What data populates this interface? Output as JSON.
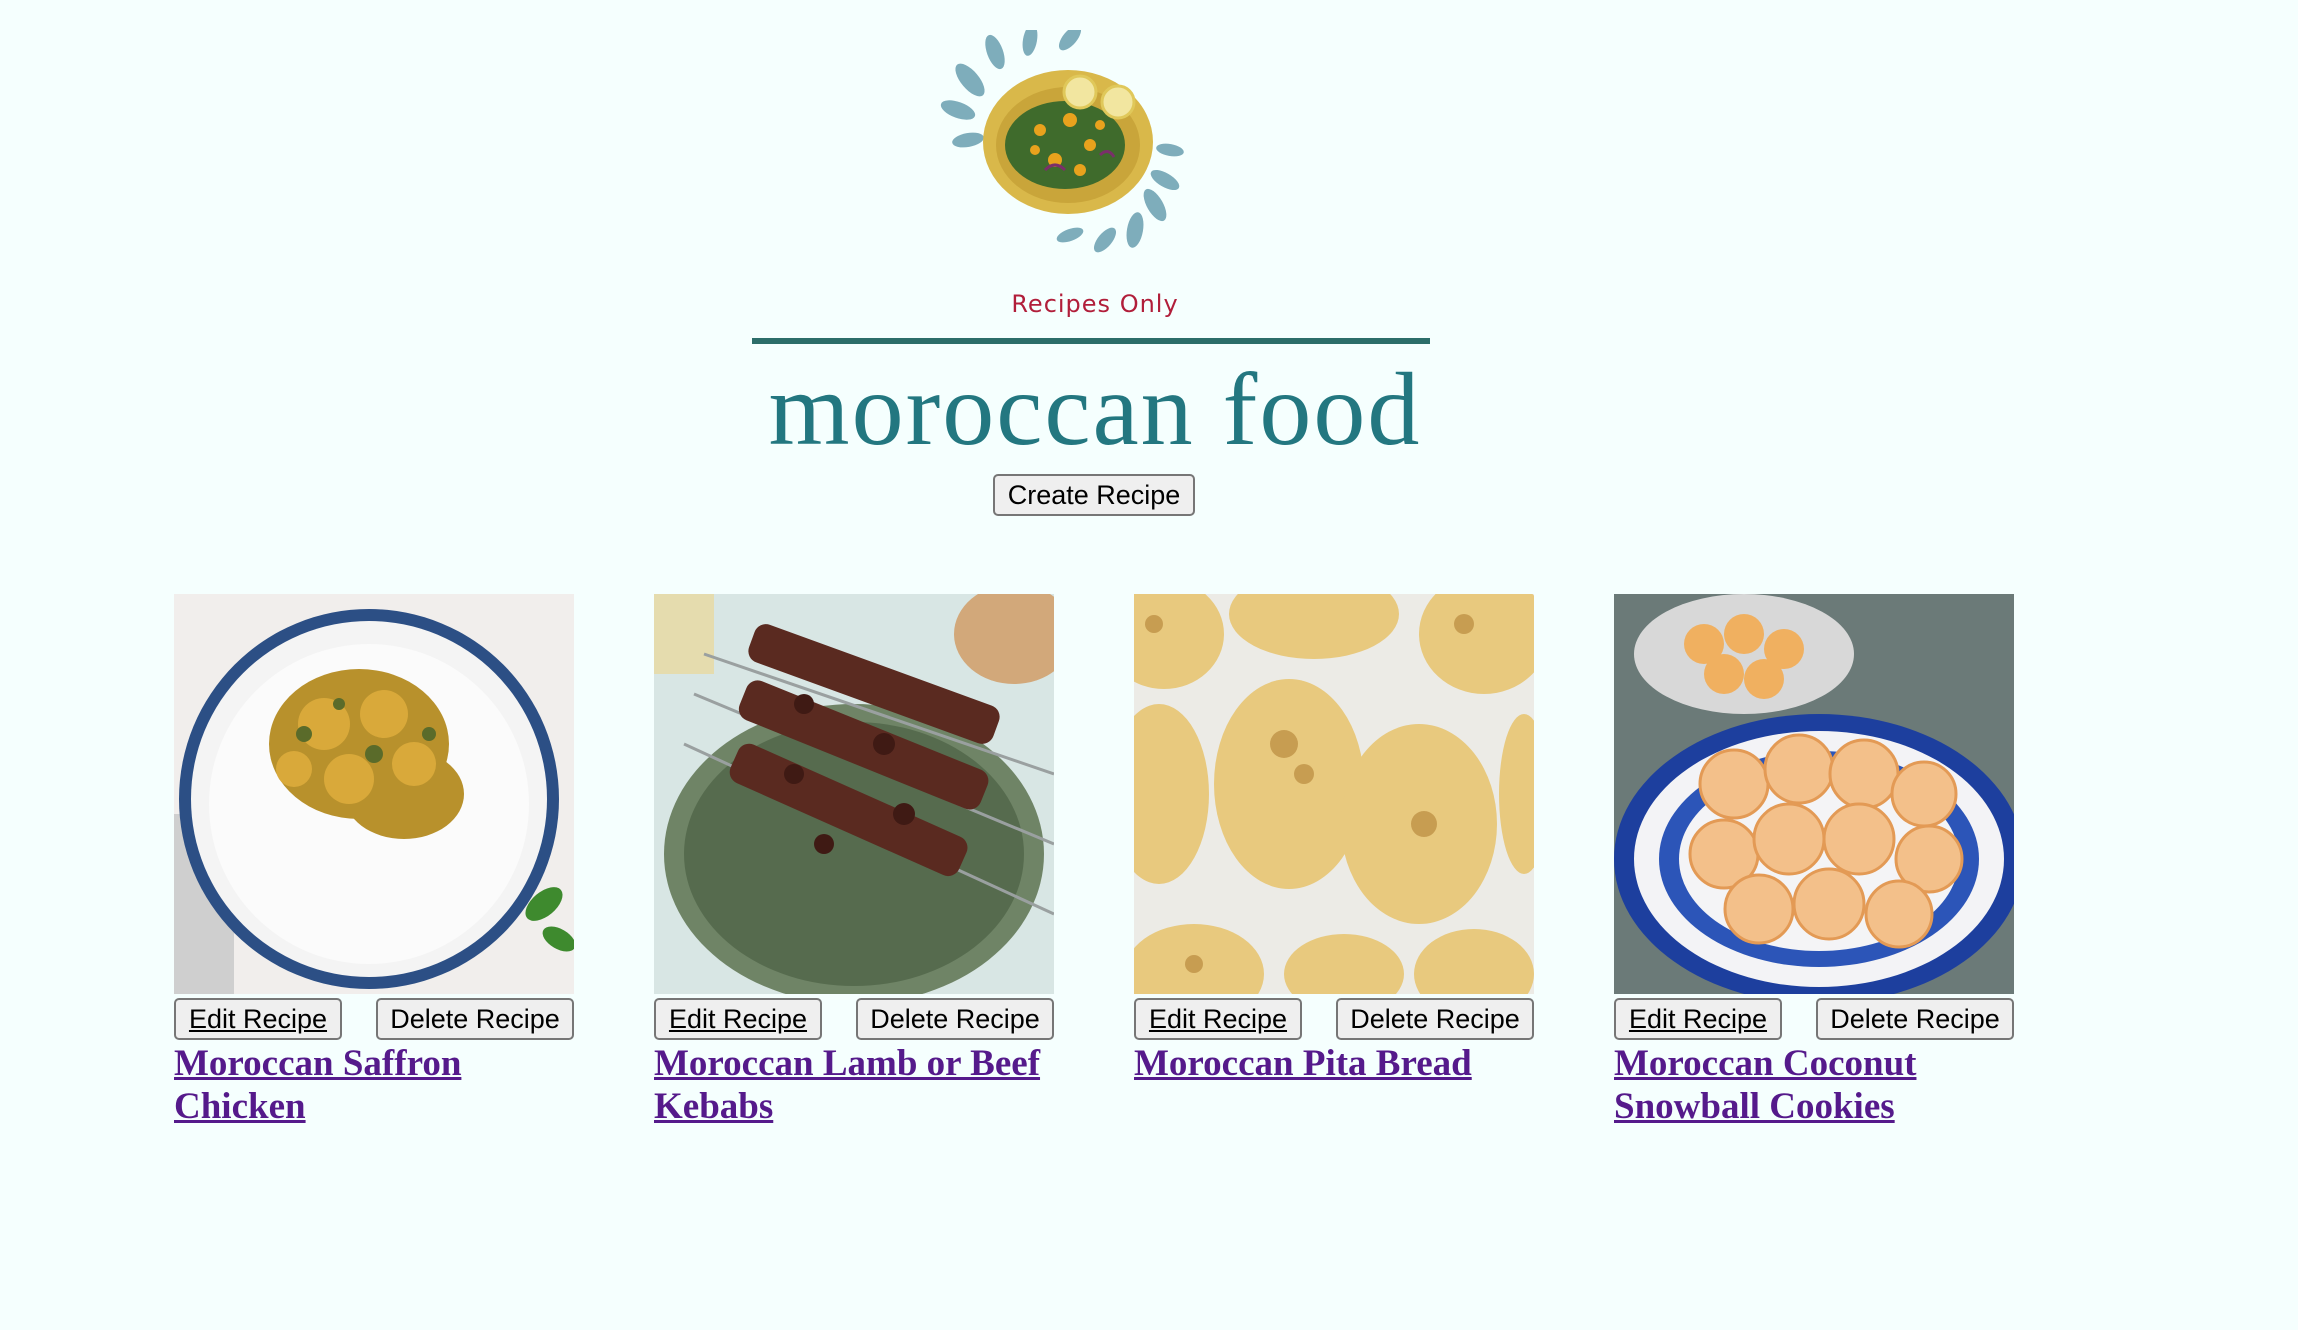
{
  "header": {
    "logo_icon": "salad-plate-logo",
    "tagline": "Recipes Only",
    "title": "moroccan food",
    "create_label": "Create Recipe"
  },
  "recipes": [
    {
      "title": "Moroccan Saffron Chicken",
      "image": "saffron-chicken-image",
      "edit_label": "Edit Recipe",
      "delete_label": "Delete Recipe"
    },
    {
      "title": "Moroccan Lamb or Beef Kebabs",
      "image": "kebabs-image",
      "edit_label": "Edit Recipe",
      "delete_label": "Delete Recipe"
    },
    {
      "title": "Moroccan Pita Bread",
      "image": "pita-bread-image",
      "edit_label": "Edit Recipe",
      "delete_label": "Delete Recipe"
    },
    {
      "title": "Moroccan Coconut Snowball Cookies",
      "image": "coconut-cookies-image",
      "edit_label": "Edit Recipe",
      "delete_label": "Delete Recipe"
    }
  ],
  "colors": {
    "background": "#f5fffe",
    "title": "#237780",
    "tagline": "#b11e3a",
    "rule": "#2c6e6a",
    "link": "#551a8b"
  }
}
